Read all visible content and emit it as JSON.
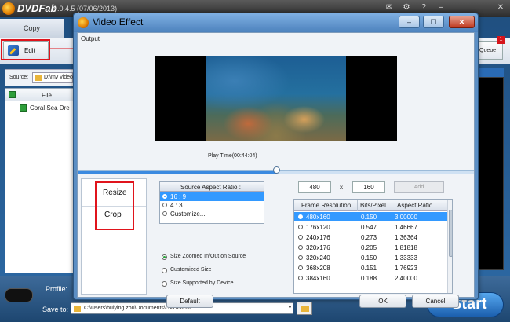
{
  "app": {
    "name": "DVDFab",
    "version": "9.0.4.5 (07/06/2013)",
    "copy_tab": "Copy",
    "edit_label": "Edit",
    "queue_label": "Queue",
    "queue_badge": "1",
    "source_label": "Source:",
    "source_path": "D:\\my video",
    "file_column": "File",
    "file_row": "Coral Sea Dre",
    "profile_label": "Profile:",
    "saveto_label": "Save to:",
    "saveto_path": "C:\\Users\\huiying zou\\Documents\\DVDFab9\\",
    "start_label": "Start",
    "window_icons": [
      "mail-icon",
      "gear-icon",
      "help-icon",
      "minimize-icon",
      "close-icon"
    ]
  },
  "dialog": {
    "title": "Video Effect",
    "output_label": "Output",
    "play_time": "Play Time(00:44:04)",
    "seek_progress": 0.5,
    "tabs": [
      "Resize",
      "Crop"
    ],
    "aspect_header": "Source Aspect Ratio :",
    "aspect_options": [
      {
        "label": "16 : 9",
        "selected": true
      },
      {
        "label": "4 : 3",
        "selected": false
      },
      {
        "label": "Customize...",
        "selected": false
      }
    ],
    "zoom_options": [
      {
        "label": "Size Zoomed In/Out on Source",
        "selected": true
      },
      {
        "label": "Customized Size",
        "selected": false
      },
      {
        "label": "Size Supported by Device",
        "selected": false
      }
    ],
    "width_value": "480",
    "times": "x",
    "height_value": "160",
    "add_label": "Add",
    "table_headers": [
      "Frame Resolution",
      "Bits/Pixel",
      "Aspect Ratio"
    ],
    "table_rows": [
      {
        "res": "480x160",
        "bits": "0.150",
        "ratio": "3.00000",
        "selected": true
      },
      {
        "res": "176x120",
        "bits": "0.547",
        "ratio": "1.46667",
        "selected": false
      },
      {
        "res": "240x176",
        "bits": "0.273",
        "ratio": "1.36364",
        "selected": false
      },
      {
        "res": "320x176",
        "bits": "0.205",
        "ratio": "1.81818",
        "selected": false
      },
      {
        "res": "320x240",
        "bits": "0.150",
        "ratio": "1.33333",
        "selected": false
      },
      {
        "res": "368x208",
        "bits": "0.151",
        "ratio": "1.76923",
        "selected": false
      },
      {
        "res": "384x160",
        "bits": "0.188",
        "ratio": "2.40000",
        "selected": false
      }
    ],
    "default_label": "Default",
    "ok_label": "OK",
    "cancel_label": "Cancel",
    "window_buttons": [
      "minimize-icon",
      "maximize-icon",
      "close-icon"
    ]
  },
  "colors": {
    "accent": "#3399ff",
    "annotation_red": "#e0141c",
    "titlebar_blue": "#5b8ec4"
  }
}
